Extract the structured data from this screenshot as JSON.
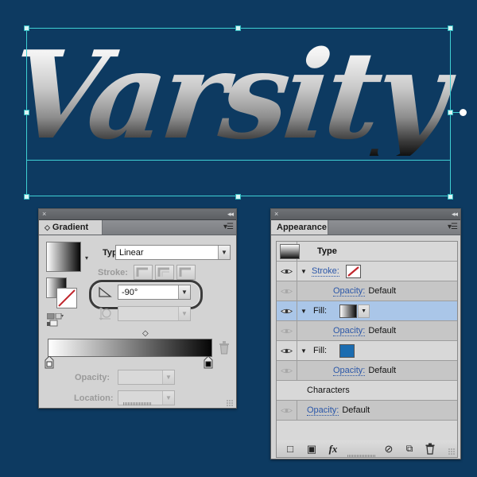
{
  "app": {
    "canvas_background": "#0d3a61",
    "artwork_text": "Varsity"
  },
  "selection": {
    "handle_color": "#3fd0d4",
    "annotator_handle": "gradient-annotator-endpoint"
  },
  "gradient_panel": {
    "titlebar": {
      "close_icon": "×",
      "collapse_icon": "◀◀"
    },
    "tab_label": "Gradient",
    "tab_grip_icon": "◇",
    "menu_icon": "▾☰",
    "swatch_dropdown_icon": "▾",
    "type_label": "Type:",
    "type_value": "Linear",
    "type_dropdown_icon": "▼",
    "stroke_label": "Stroke:",
    "stroke_buttons": [
      "stroke-within",
      "stroke-centered",
      "stroke-outside"
    ],
    "angle_icon": "∠",
    "angle_value": "-90°",
    "angle_dropdown_icon": "▼",
    "aspect_icon": "⇕○",
    "aspect_value": "",
    "aspect_dropdown_icon": "▼",
    "reverse_icon": "reverse-gradient",
    "fill_stroke_icon": "fill-stroke-indicator",
    "midpoint_icon": "◇",
    "stop_left_color": "#ffffff",
    "stop_right_color": "#000000",
    "delete_stop_icon": "🗑",
    "opacity_label": "Opacity:",
    "opacity_value": "",
    "opacity_dropdown_icon": "▼",
    "location_label": "Location:",
    "location_value": "",
    "location_dropdown_icon": "▼"
  },
  "appearance_panel": {
    "titlebar": {
      "close_icon": "×",
      "collapse_icon": "◀◀"
    },
    "tab_label": "Appearance",
    "menu_icon": "▾☰",
    "rows": [
      {
        "name": "type-header",
        "style": "plain",
        "eye": false,
        "triangle": false,
        "label": "Type",
        "label_kind": "plain",
        "thumb": "gradient",
        "value": ""
      },
      {
        "name": "stroke",
        "style": "plain",
        "eye": true,
        "triangle": true,
        "label": "Stroke:",
        "label_kind": "link",
        "thumb": "none-swatch",
        "value": ""
      },
      {
        "name": "stroke-opacity",
        "style": "alt",
        "eye": true,
        "eye_dim": true,
        "triangle": false,
        "label": "Opacity:",
        "label_kind": "link",
        "thumb": "",
        "value": "Default",
        "indent": 60
      },
      {
        "name": "fill-gradient",
        "style": "sel",
        "eye": true,
        "triangle": true,
        "label": "Fill:",
        "label_kind": "plain",
        "thumb": "gradient-with-dropdown",
        "value": ""
      },
      {
        "name": "fill-gradient-opacity",
        "style": "alt",
        "eye": true,
        "eye_dim": true,
        "triangle": false,
        "label": "Opacity:",
        "label_kind": "link",
        "thumb": "",
        "value": "Default",
        "indent": 60
      },
      {
        "name": "fill-blue",
        "style": "plain",
        "eye": true,
        "triangle": true,
        "label": "Fill:",
        "label_kind": "plain",
        "thumb": "blue",
        "value": ""
      },
      {
        "name": "fill-blue-opacity",
        "style": "alt",
        "eye": true,
        "eye_dim": true,
        "triangle": false,
        "label": "Opacity:",
        "label_kind": "link",
        "thumb": "",
        "value": "Default",
        "indent": 60
      },
      {
        "name": "characters",
        "style": "plain",
        "eye": false,
        "triangle": false,
        "label": "Characters",
        "label_kind": "plain",
        "thumb": "",
        "value": "",
        "indent": 35
      },
      {
        "name": "characters-opacity",
        "style": "alt",
        "eye": true,
        "eye_dim": true,
        "triangle": false,
        "label": "Opacity:",
        "label_kind": "link",
        "thumb": "",
        "value": "Default",
        "indent": 35
      },
      {
        "name": "empty",
        "style": "plain",
        "eye": false,
        "triangle": false,
        "label": "",
        "label_kind": "plain",
        "thumb": "",
        "value": ""
      }
    ],
    "blue_swatch_color": "#1b6cb0",
    "bottom_buttons": [
      {
        "name": "add-new-stroke-button",
        "icon": "□"
      },
      {
        "name": "add-new-fill-button",
        "icon": "▣"
      },
      {
        "name": "add-new-effect-button",
        "icon": "fx"
      },
      {
        "name": "clear-appearance-button",
        "icon": "⊘"
      },
      {
        "name": "duplicate-item-button",
        "icon": "⧉"
      },
      {
        "name": "delete-item-button",
        "icon": "🗑"
      }
    ]
  }
}
